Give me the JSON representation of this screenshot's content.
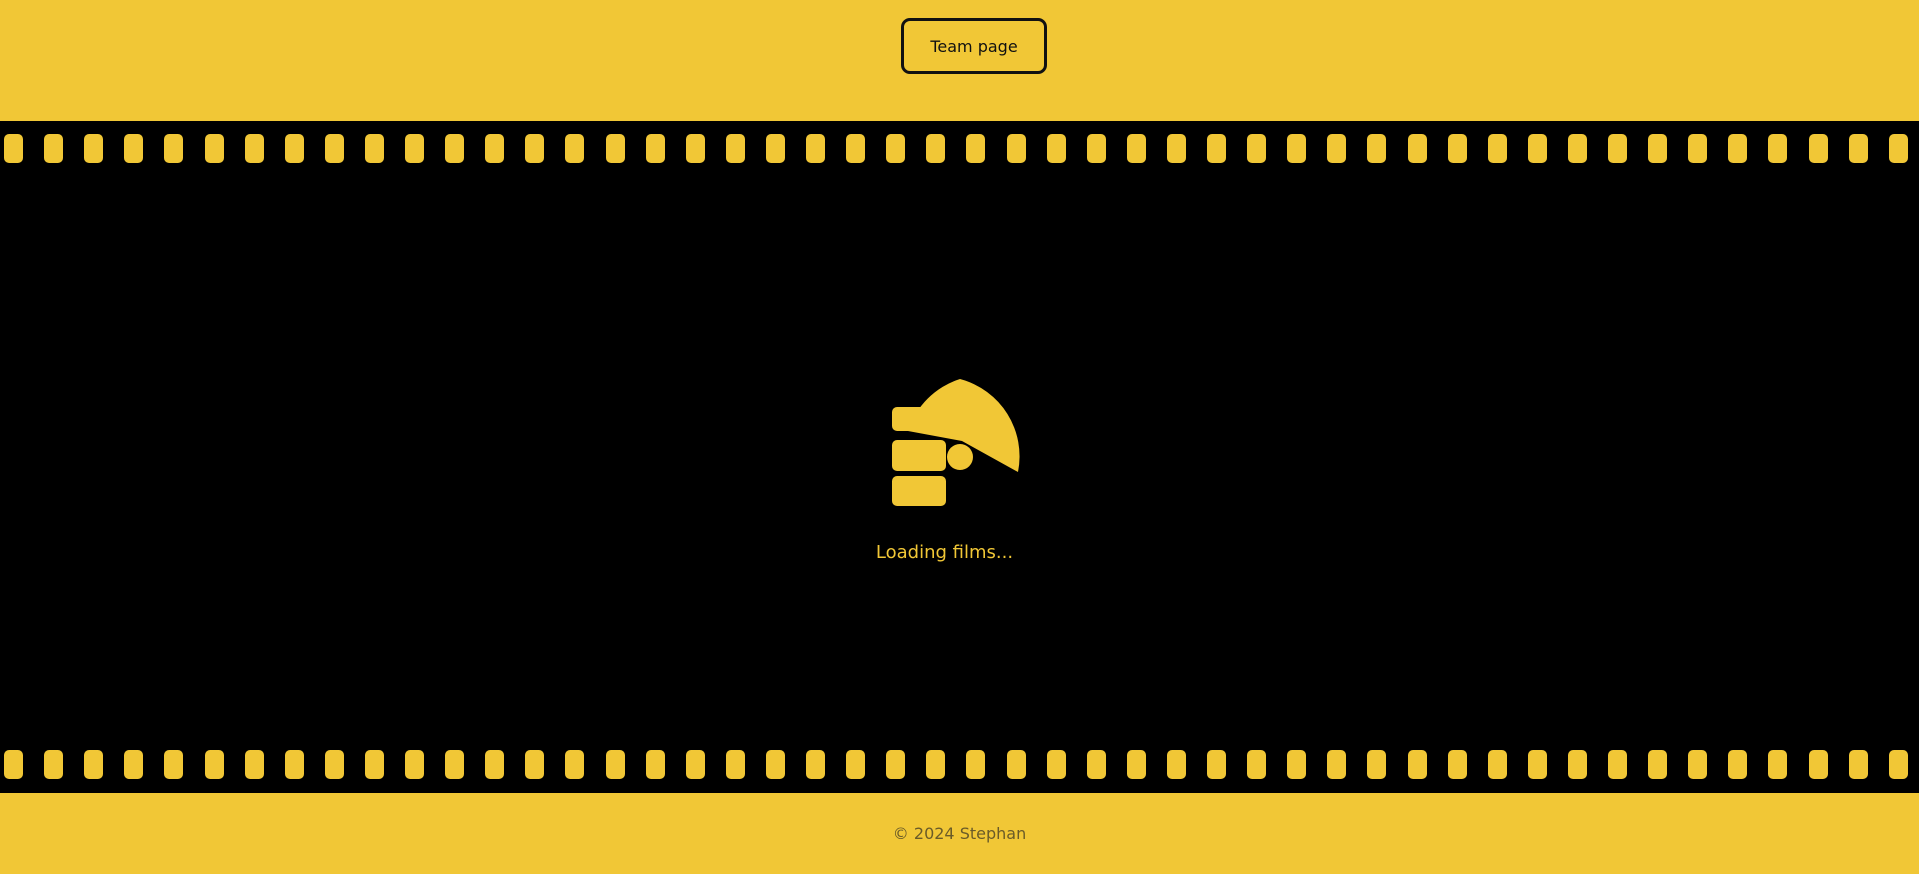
{
  "header": {
    "team_button_label": "Team page"
  },
  "film": {
    "loader_icon": "film-projector-loading-icon",
    "loading_text": "Loading films..."
  },
  "footer": {
    "copyright": "© 2024 Stephan"
  },
  "colors": {
    "accent": "#f1c736",
    "background": "#000000",
    "button_border": "#111111",
    "footer_text": "#6a5b28"
  }
}
